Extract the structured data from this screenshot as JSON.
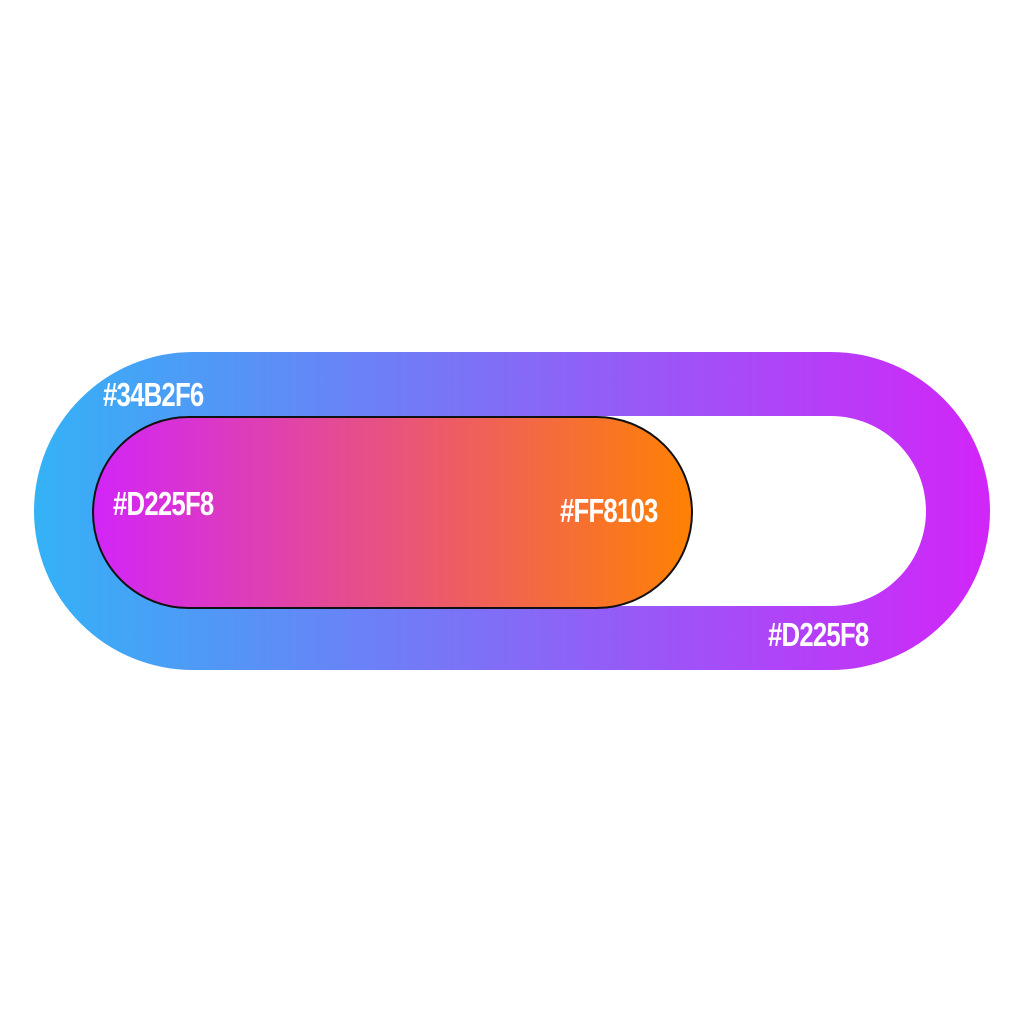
{
  "toggle": {
    "outer_track": {
      "gradient_start": "#34B2F6",
      "gradient_end": "#D225F8",
      "start_label": "#34B2F6",
      "end_label": "#D225F8"
    },
    "knob": {
      "gradient_start": "#D225F8",
      "gradient_end": "#FF8103",
      "start_label": "#D225F8",
      "end_label": "#FF8103"
    }
  }
}
